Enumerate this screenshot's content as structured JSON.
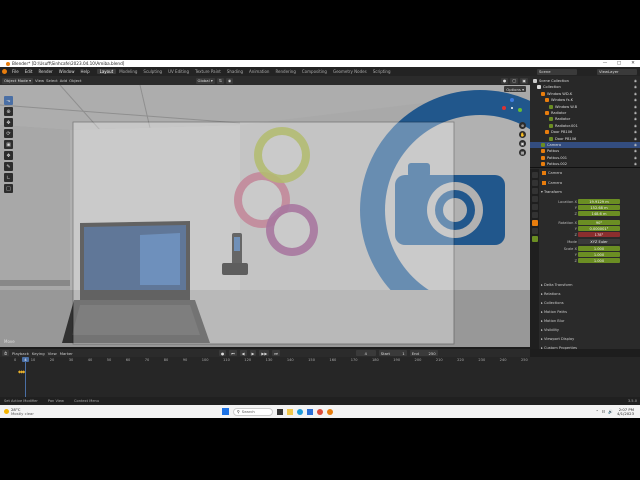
{
  "window": {
    "title": "Blender* [D:\\Usuff\\Sinhcafe\\2023.04.10\\Amiba.blend]"
  },
  "menu": [
    "File",
    "Edit",
    "Render",
    "Window",
    "Help"
  ],
  "workspaces": [
    "Layout",
    "Modeling",
    "Sculpting",
    "UV Editing",
    "Texture Paint",
    "Shading",
    "Animation",
    "Rendering",
    "Compositing",
    "Geometry Nodes",
    "Scripting"
  ],
  "active_workspace": "Layout",
  "scene": {
    "label": "Scene",
    "view_layer": "ViewLayer"
  },
  "viewport_header": {
    "mode": "Object Mode",
    "menus": [
      "View",
      "Select",
      "Add",
      "Object"
    ],
    "orientation": "Global",
    "options": "Options"
  },
  "outliner": {
    "items": [
      {
        "label": "Scene Collection",
        "indent": 0
      },
      {
        "label": "Collection",
        "indent": 1
      },
      {
        "label": "Window WD-K",
        "indent": 2
      },
      {
        "label": "Window fs.K",
        "indent": 3
      },
      {
        "label": "Window W.B",
        "indent": 4
      },
      {
        "label": "Radiator",
        "indent": 3
      },
      {
        "label": "Radiator",
        "indent": 4
      },
      {
        "label": "Radiator.001",
        "indent": 4
      },
      {
        "label": "Door PB106",
        "indent": 3
      },
      {
        "label": "Door PB106",
        "indent": 4
      },
      {
        "label": "Camera",
        "indent": 2,
        "selected": true
      },
      {
        "label": "Potbus",
        "indent": 2
      },
      {
        "label": "Potbus.001",
        "indent": 2
      },
      {
        "label": "Potbus.002",
        "indent": 2
      }
    ]
  },
  "properties": {
    "object_name": "Camera",
    "sub_name": "Camera",
    "transform_header": "Transform",
    "location": {
      "label": "Location X",
      "x": "19.9129 m",
      "y": "152.68 m",
      "z": "148.6 m"
    },
    "rotation": {
      "label": "Rotation X",
      "x": "90°",
      "y": "0.000001°",
      "z": "178°"
    },
    "mode": {
      "label": "Mode",
      "value": "XYZ Euler"
    },
    "scale": {
      "label": "Scale X",
      "x": "1.000",
      "y": "1.000",
      "z": "1.000"
    },
    "axis": {
      "y": "Y",
      "z": "Z"
    },
    "panels": [
      "Delta Transform",
      "Relations",
      "Collections",
      "Motion Paths",
      "Motion Blur",
      "Visibility",
      "Viewport Display",
      "Custom Properties"
    ]
  },
  "timeline": {
    "menus": [
      "Playback",
      "Keying",
      "View",
      "Marker"
    ],
    "current_frame": "4",
    "start_label": "Start",
    "start": "1",
    "end_label": "End",
    "end": "250",
    "ticks": [
      "0",
      "10",
      "20",
      "30",
      "40",
      "50",
      "60",
      "70",
      "80",
      "90",
      "100",
      "110",
      "120",
      "130",
      "140",
      "150",
      "160",
      "170",
      "180",
      "190",
      "200",
      "210",
      "220",
      "230",
      "240",
      "250"
    ],
    "cursor_frame": "4"
  },
  "statusbar": {
    "items": [
      "Set Active Modifier",
      "Pan View",
      "Context Menu"
    ],
    "version": "3.5.0"
  },
  "viewport_overlay": {
    "camera_label": "Move"
  },
  "taskbar": {
    "weather_temp": "28°C",
    "weather_desc": "Mostly clear",
    "search_placeholder": "Search",
    "time": "2:07 PM",
    "date": "4/1/2023"
  },
  "colors": {
    "accent": "#4a6fa5",
    "field_green": "#6b8e23",
    "field_red": "#8b2e2e",
    "selected_row": "#334d80"
  }
}
